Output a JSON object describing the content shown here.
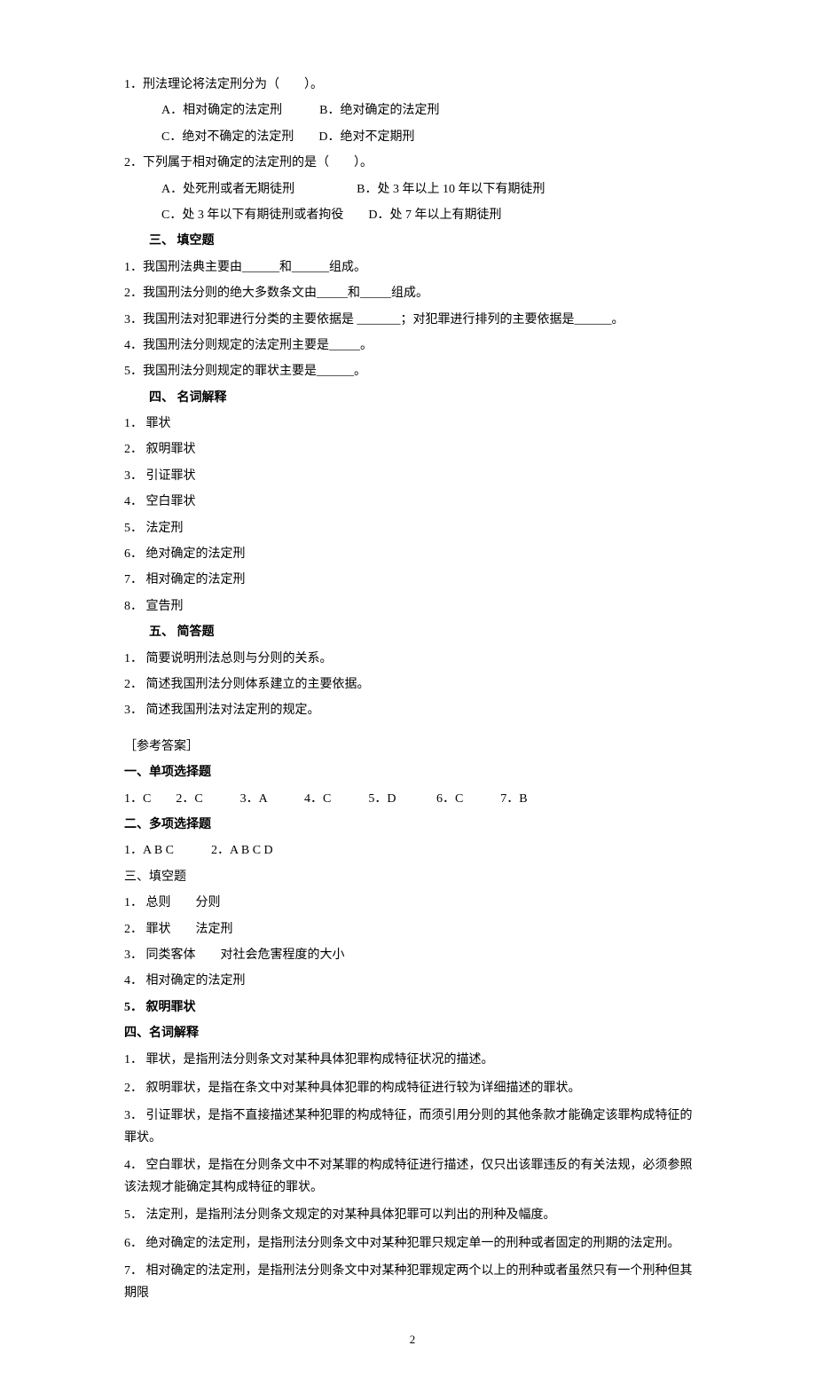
{
  "q1": {
    "stem": "1．刑法理论将法定刑分为（　　）。",
    "opts_row1": "A．相对确定的法定刑　　　B．绝对确定的法定刑",
    "opts_row2": "C．绝对不确定的法定刑　　D．绝对不定期刑"
  },
  "q2": {
    "stem": "2．下列属于相对确定的法定刑的是（　　）。",
    "opts_row1": "A．处死刑或者无期徒刑　　　　　B．处 3 年以上 10 年以下有期徒刑",
    "opts_row2": "C．处 3 年以下有期徒刑或者拘役　　D．处 7 年以上有期徒刑"
  },
  "sec3_title": "三、 填空题",
  "fill": [
    "1．我国刑法典主要由______和______组成。",
    "2．我国刑法分则的绝大多数条文由_____和_____组成。",
    "3．我国刑法对犯罪进行分类的主要依据是 _______；对犯罪进行排列的主要依据是______。",
    "4．我国刑法分则规定的法定刑主要是_____。",
    "5．我国刑法分则规定的罪状主要是______。"
  ],
  "sec4_title": "四、 名词解释",
  "terms": [
    "1． 罪状",
    "2． 叙明罪状",
    "3． 引证罪状",
    "4． 空白罪状",
    "5． 法定刑",
    "6． 绝对确定的法定刑",
    "7． 相对确定的法定刑",
    "8． 宣告刑"
  ],
  "sec5_title": "五、 简答题",
  "shortans": [
    "1． 简要说明刑法总则与分则的关系。",
    "2． 简述我国刑法分则体系建立的主要依据。",
    "3． 简述我国刑法对法定刑的规定。"
  ],
  "answers_header": "［参考答案］",
  "ans_sec1_title": "一、单项选择题",
  "ans_sec1_line": "1．C　　2．C　　　3．A　　　4．C　　　5．D　　　  6．C　　　7．B",
  "ans_sec2_title": "二、多项选择题",
  "ans_sec2_line": "1．A B C　　　2．A B C D",
  "ans_sec3_title": "三、填空题",
  "ans_fill": [
    "1． 总则　　分则",
    "2． 罪状　　法定刑",
    "3． 同类客体　　对社会危害程度的大小",
    "4． 相对确定的法定刑",
    "5． 叙明罪状"
  ],
  "ans_sec4_title": "四、名词解释",
  "ans_terms": [
    "1． 罪状，是指刑法分则条文对某种具体犯罪构成特征状况的描述。",
    "2． 叙明罪状，是指在条文中对某种具体犯罪的构成特征进行较为详细描述的罪状。",
    "3． 引证罪状，是指不直接描述某种犯罪的构成特征，而须引用分则的其他条款才能确定该罪构成特征的罪状。",
    "4． 空白罪状，是指在分则条文中不对某罪的构成特征进行描述，仅只出该罪违反的有关法规，必须参照该法规才能确定其构成特征的罪状。",
    "5． 法定刑，是指刑法分则条文规定的对某种具体犯罪可以判出的刑种及幅度。",
    "6． 绝对确定的法定刑，是指刑法分则条文中对某种犯罪只规定单一的刑种或者固定的刑期的法定刑。",
    "7． 相对确定的法定刑，是指刑法分则条文中对某种犯罪规定两个以上的刑种或者虽然只有一个刑种但其期限"
  ],
  "page_number": "2"
}
